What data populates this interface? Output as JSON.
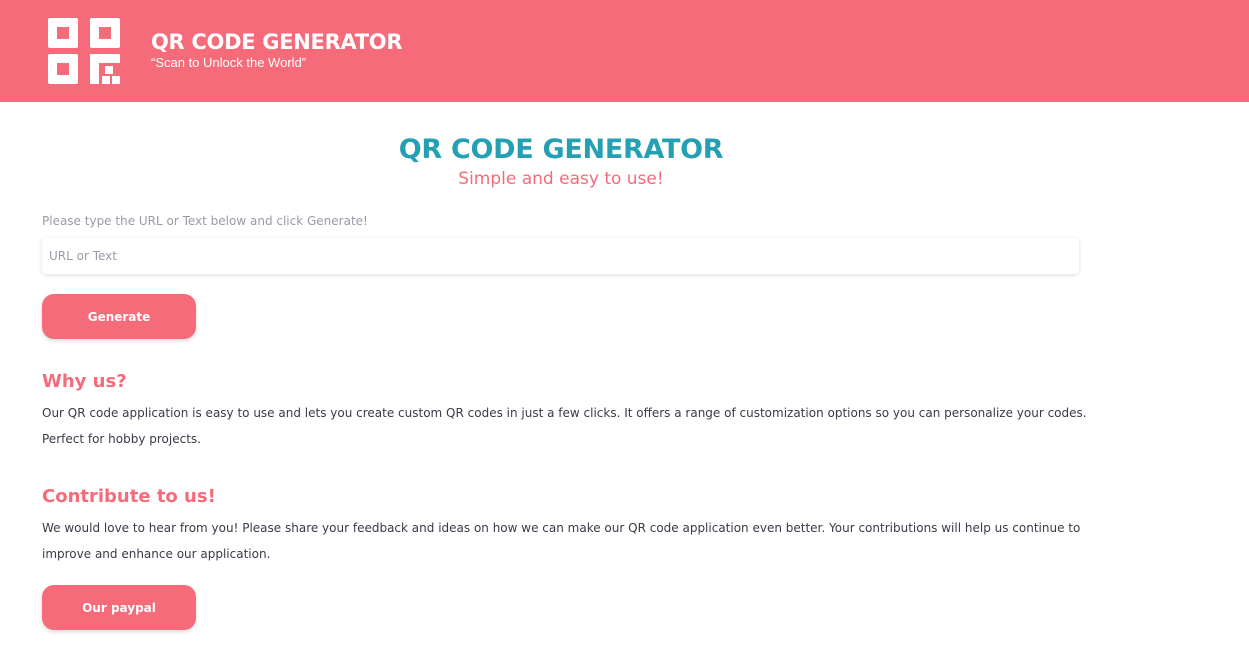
{
  "header": {
    "title": "QR CODE GENERATOR",
    "tagline": "“Scan to Unlock the World”",
    "logo_icon": "qr-code-icon"
  },
  "hero": {
    "title": "QR CODE GENERATOR",
    "subtitle": "Simple and easy to use!"
  },
  "form": {
    "instruction": "Please type the URL or Text below and click Generate!",
    "input_value": "",
    "input_placeholder": "URL or Text",
    "generate_label": "Generate"
  },
  "why_us": {
    "heading": "Why us?",
    "text": "Our QR code application is easy to use and lets you create custom QR codes in just a few clicks. It offers a range of customization options so you can personalize your codes. Perfect for hobby projects."
  },
  "contribute": {
    "heading": "Contribute to us!",
    "text": "We would love to hear from you! Please share your feedback and ideas on how we can make our QR code application even better. Your contributions will help us continue to improve and enhance our application.",
    "paypal_label": "Our paypal"
  },
  "colors": {
    "accent": "#f56b7a",
    "title": "#25a0b3",
    "muted": "#9a9aa6",
    "body_text": "#3a3a48"
  }
}
